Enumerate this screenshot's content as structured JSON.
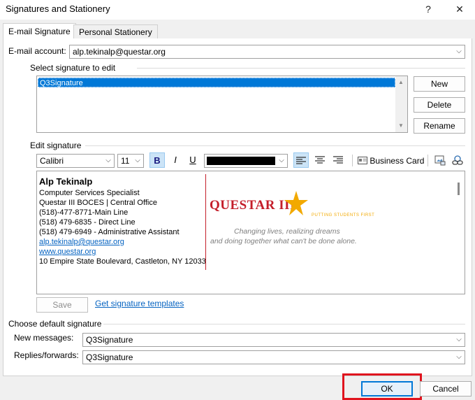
{
  "window": {
    "title": "Signatures and Stationery",
    "help_glyph": "?",
    "close_glyph": "✕"
  },
  "tabs": [
    {
      "label": "E-mail Signature",
      "active": true
    },
    {
      "label": "Personal Stationery",
      "active": false
    }
  ],
  "account": {
    "label": "E-mail account:",
    "value": "alp.tekinalp@questar.org"
  },
  "select_signature": {
    "group_label": "Select signature to edit",
    "items": [
      "Q3Signature"
    ],
    "selected": "Q3Signature"
  },
  "side_buttons": {
    "new": "New",
    "delete": "Delete",
    "rename": "Rename"
  },
  "edit_signature": {
    "group_label": "Edit signature",
    "font": "Calibri",
    "size": "11",
    "bold": "B",
    "italic": "I",
    "underline": "U",
    "business_card": "Business Card",
    "font_color": "#000000"
  },
  "signature": {
    "name": "Alp Tekinalp",
    "lines": [
      "Computer Services Specialist",
      "Questar III BOCES | Central Office",
      "(518)-477-8771-Main Line",
      "(518) 479-6835 - Direct Line",
      "(518) 479-6949 - Administrative Assistant"
    ],
    "email": "alp.tekinalp@questar.org",
    "website": "www.questar.org",
    "address": "10 Empire State Boulevard, Castleton, NY 12033",
    "logo_text": "QUESTAR III",
    "logo_sub": "PUTTING STUDENTS FIRST",
    "tagline1": "Changing lives, realizing dreams",
    "tagline2": "and doing together what can't be done alone."
  },
  "save_label": "Save",
  "templates_link": "Get signature templates",
  "defaults": {
    "group_label": "Choose default signature",
    "new_label": "New messages:",
    "new_value": "Q3Signature",
    "replies_label": "Replies/forwards:",
    "replies_value": "Q3Signature"
  },
  "footer": {
    "ok": "OK",
    "cancel": "Cancel"
  },
  "colors": {
    "accent": "#0078d7",
    "highlight_box": "#e0141e",
    "logo_red": "#c41e2a",
    "logo_gold": "#f2a900"
  }
}
